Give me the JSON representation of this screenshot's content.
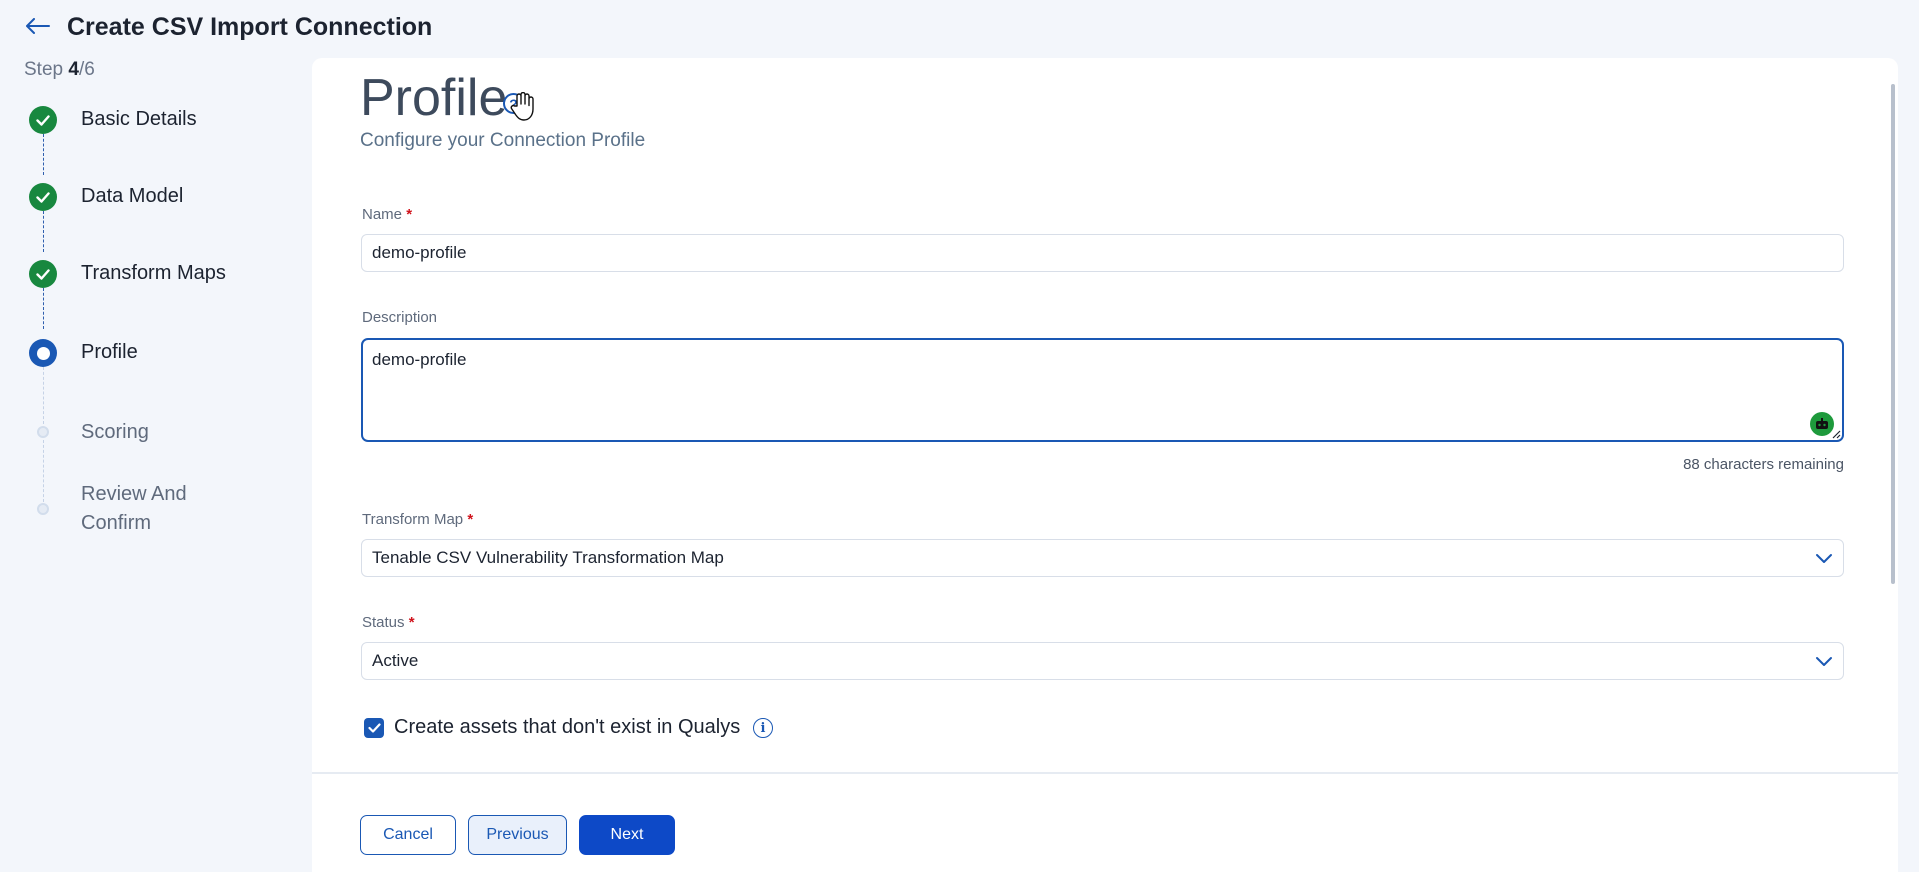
{
  "header": {
    "title": "Create CSV Import Connection"
  },
  "stepper": {
    "step_prefix": "Step ",
    "current": "4",
    "total_suffix": "/6",
    "steps": [
      {
        "label": "Basic Details",
        "state": "done"
      },
      {
        "label": "Data Model",
        "state": "done"
      },
      {
        "label": "Transform Maps",
        "state": "done"
      },
      {
        "label": "Profile",
        "state": "current"
      },
      {
        "label": "Scoring",
        "state": "pending"
      },
      {
        "label": "Review And Confirm",
        "state": "pending"
      }
    ]
  },
  "form": {
    "title": "Profile",
    "help_glyph": "?",
    "subtitle": "Configure your Connection Profile",
    "name": {
      "label": "Name",
      "required_mark": "*",
      "value": "demo-profile"
    },
    "description": {
      "label": "Description",
      "value": "demo-profile",
      "char_count": "88 characters remaining"
    },
    "transform_map": {
      "label": "Transform Map",
      "required_mark": "*",
      "value": "Tenable CSV Vulnerability Transformation Map"
    },
    "status": {
      "label": "Status",
      "required_mark": "*",
      "value": "Active"
    },
    "create_assets": {
      "label": "Create assets that don't exist in Qualys",
      "checked": true,
      "info_glyph": "i"
    }
  },
  "footer": {
    "cancel_label": "Cancel",
    "previous_label": "Previous",
    "next_label": "Next"
  },
  "colors": {
    "primary": "#1a58b4",
    "done": "#18883f",
    "next_button": "#0d49c7"
  }
}
